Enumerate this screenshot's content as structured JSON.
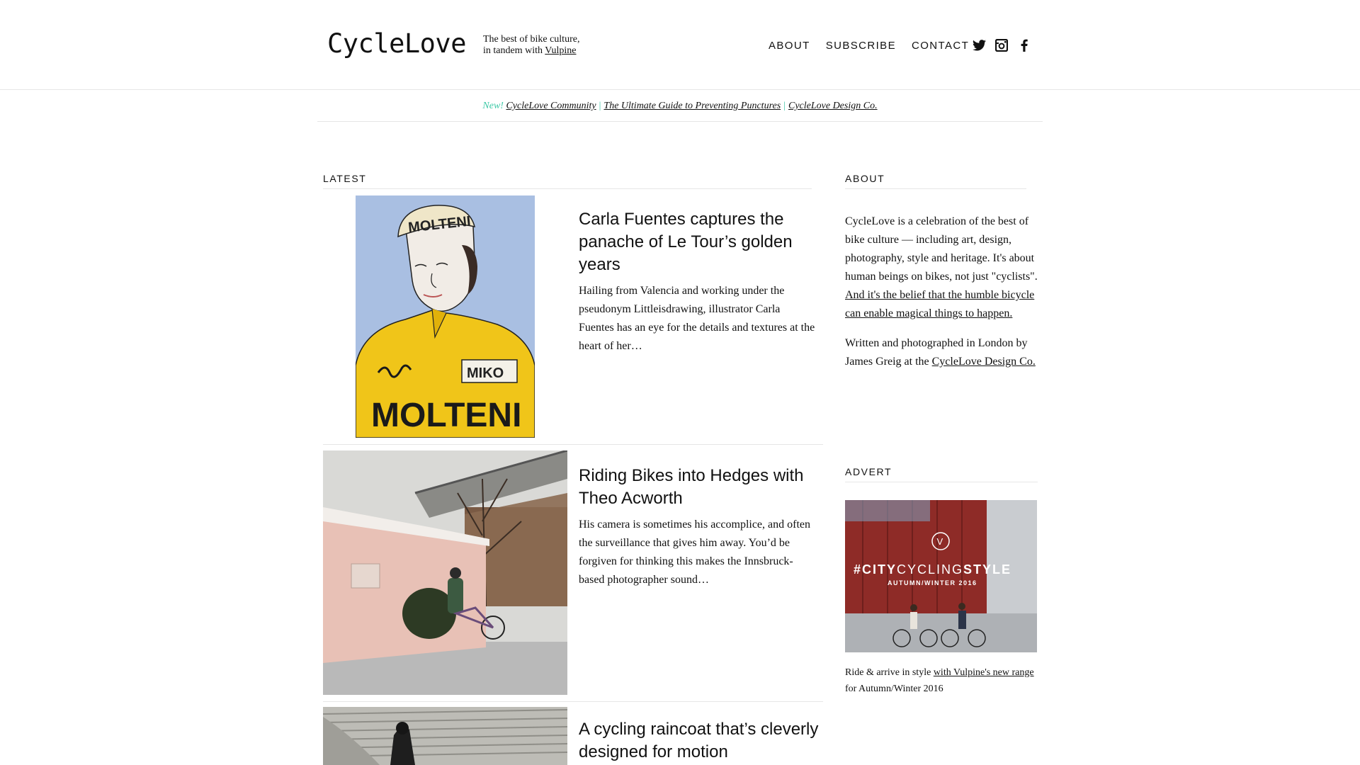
{
  "header": {
    "logo": "CycleLove",
    "tagline_line1": "The best of bike culture,",
    "tagline_line2_prefix": "in tandem with ",
    "tagline_link": "Vulpine",
    "nav": [
      "ABOUT",
      "SUBSCRIBE",
      "CONTACT"
    ],
    "social_icons": [
      "twitter-icon",
      "instagram-icon",
      "facebook-icon"
    ]
  },
  "promo": {
    "new_label": "New!",
    "links": [
      "CycleLove Community",
      "The Ultimate Guide to Preventing Punctures",
      "CycleLove Design Co."
    ],
    "separator": "|"
  },
  "latest": {
    "heading": "LATEST",
    "articles": [
      {
        "title": "Carla Fuentes captures the panache of Le Tour’s golden years",
        "excerpt": "Hailing from Valencia and working under the pseudonym Littleisdrawing, illustrator Carla Fuentes has an eye for the details and textures at the heart of her…",
        "image_text_cap": "MOLTENI",
        "image_text_badge": "MIKO",
        "image_text_chest": "MOLTENI"
      },
      {
        "title": "Riding Bikes into Hedges with Theo Acworth",
        "excerpt": "His camera is sometimes his accomplice, and often the surveillance that gives him away. You’d be forgiven for thinking this makes the Innsbruck-based photographer sound…"
      },
      {
        "title": "A cycling raincoat that’s cleverly designed for motion",
        "excerpt": ""
      }
    ]
  },
  "sidebar": {
    "about_heading": "ABOUT",
    "about_p1_text": "CycleLove is a celebration of the best of bike culture — including art, design, photography, style and heritage. It's about human beings on bikes, not just \"cyclists\". ",
    "about_p1_link": "And it's the belief that the humble bicycle can enable magical things to happen.",
    "about_p2_text": "Written and photographed in London by James Greig at the ",
    "about_p2_link": "CycleLove Design Co.",
    "advert_heading": "ADVERT",
    "advert_image_title_bold": "#CITY",
    "advert_image_title_light": "CYCLING",
    "advert_image_title_bold2": "STYLE",
    "advert_image_subtitle": "AUTUMN/WINTER 2016",
    "advert_image_logo": "V",
    "advert_caption_prefix": "Ride & arrive in style ",
    "advert_caption_link": "with Vulpine's new range",
    "advert_caption_suffix": " for Autumn/Winter 2016"
  },
  "colors": {
    "accent": "#3ec9a7",
    "divider": "#e6e6e6",
    "text": "#111111"
  }
}
